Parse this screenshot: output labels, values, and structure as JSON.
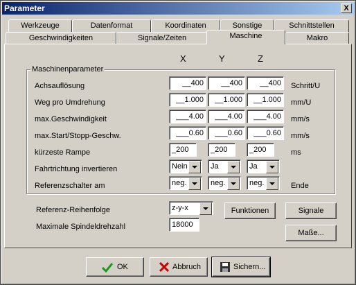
{
  "window": {
    "title": "Parameter",
    "close_label": "X"
  },
  "tabs_back": [
    "Werkzeuge",
    "Datenformat",
    "Koordinaten",
    "Sonstige",
    "Schnittstellen"
  ],
  "tabs_front": [
    "Geschwindigkeiten",
    "Signale/Zeiten",
    "Maschine",
    "Makro"
  ],
  "active_tab": "Maschine",
  "group": {
    "title": "Maschinenparameter"
  },
  "columns": [
    "X",
    "Y",
    "Z"
  ],
  "rows": [
    {
      "label": "Achsauflösung",
      "values": [
        "__400",
        "__400",
        "__400"
      ],
      "unit": "Schritt/U"
    },
    {
      "label": "Weg pro Umdrehung",
      "values": [
        "__1.000",
        "__1.000",
        "__1.000"
      ],
      "unit": "mm/U"
    },
    {
      "label": "max.Geschwindigkeit",
      "values": [
        "___4.00",
        "___4.00",
        "___4.00"
      ],
      "unit": "mm/s"
    },
    {
      "label": "max.Start/Stopp-Geschw.",
      "values": [
        "___0.60",
        "___0.60",
        "___0.60"
      ],
      "unit": "mm/s"
    },
    {
      "label": "kürzeste Rampe",
      "values": [
        "_200",
        "_200",
        "_200"
      ],
      "unit": "ms"
    },
    {
      "label": "Fahrtrichtung invertieren",
      "values": [
        "Nein",
        "Ja",
        "Ja"
      ],
      "unit": ""
    },
    {
      "label": "Referenzschalter am",
      "values": [
        "neg.",
        "neg.",
        "neg."
      ],
      "unit": "Ende"
    }
  ],
  "ref_order": {
    "label": "Referenz-Reihenfolge",
    "value": "z-y-x"
  },
  "max_spindle": {
    "label": "Maximale Spindeldrehzahl",
    "value": "18000"
  },
  "buttons": {
    "funktionen": "Funktionen",
    "signale": "Signale",
    "masse": "Maße..."
  },
  "footer": {
    "ok": "OK",
    "abbruch": "Abbruch",
    "sichern": "Sichern..."
  },
  "colors": {
    "titlebar": "#0a246a",
    "ok_icon": "#1a9a1a",
    "cancel_icon": "#cc0000"
  },
  "icons": {
    "ok": "check-icon",
    "abbruch": "x-icon",
    "sichern": "floppy-disk-icon"
  }
}
